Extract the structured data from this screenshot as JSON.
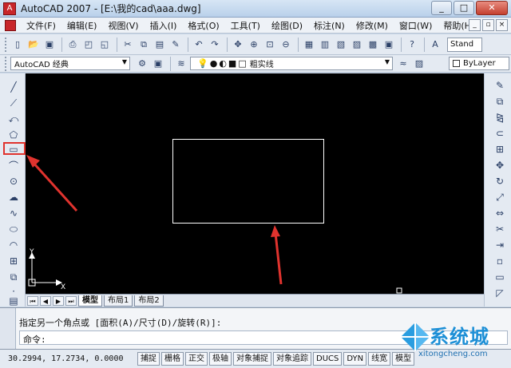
{
  "window": {
    "title": "AutoCAD 2007 - [E:\\我的cad\\aaa.dwg]",
    "minimize": "_",
    "maximize": "□",
    "close": "✕"
  },
  "menu": [
    {
      "label": "文件(F)"
    },
    {
      "label": "编辑(E)"
    },
    {
      "label": "视图(V)"
    },
    {
      "label": "插入(I)"
    },
    {
      "label": "格式(O)"
    },
    {
      "label": "工具(T)"
    },
    {
      "label": "绘图(D)"
    },
    {
      "label": "标注(N)"
    },
    {
      "label": "修改(M)"
    },
    {
      "label": "窗口(W)"
    },
    {
      "label": "帮助(H)"
    }
  ],
  "toolbar": {
    "text_style_value": "Stand"
  },
  "workspace": {
    "value": "AutoCAD 经典"
  },
  "layer": {
    "value": "粗实线"
  },
  "color_control": {
    "value": "ByLayer"
  },
  "canvas": {
    "ucs_x": "X",
    "ucs_y": "Y"
  },
  "layout_tabs": [
    {
      "label": "模型"
    },
    {
      "label": "布局1"
    },
    {
      "label": "布局2"
    }
  ],
  "command": {
    "history_line": "指定另一个角点或 [面积(A)/尺寸(D)/旋转(R)]:",
    "prompt": "命令:"
  },
  "status": {
    "coordinates": "30.2994, 17.2734, 0.0000",
    "buttons": [
      {
        "label": "捕捉"
      },
      {
        "label": "栅格"
      },
      {
        "label": "正交"
      },
      {
        "label": "极轴"
      },
      {
        "label": "对象捕捉"
      },
      {
        "label": "对象追踪"
      },
      {
        "label": "DUCS"
      },
      {
        "label": "DYN"
      },
      {
        "label": "线宽"
      },
      {
        "label": "模型"
      }
    ]
  },
  "watermark": {
    "name": "系统城",
    "url": "xitongcheng.com"
  },
  "colors": {
    "canvas_background": "#000000",
    "annotation_red": "#e0332e",
    "rectangle_stroke": "#ffffff"
  }
}
